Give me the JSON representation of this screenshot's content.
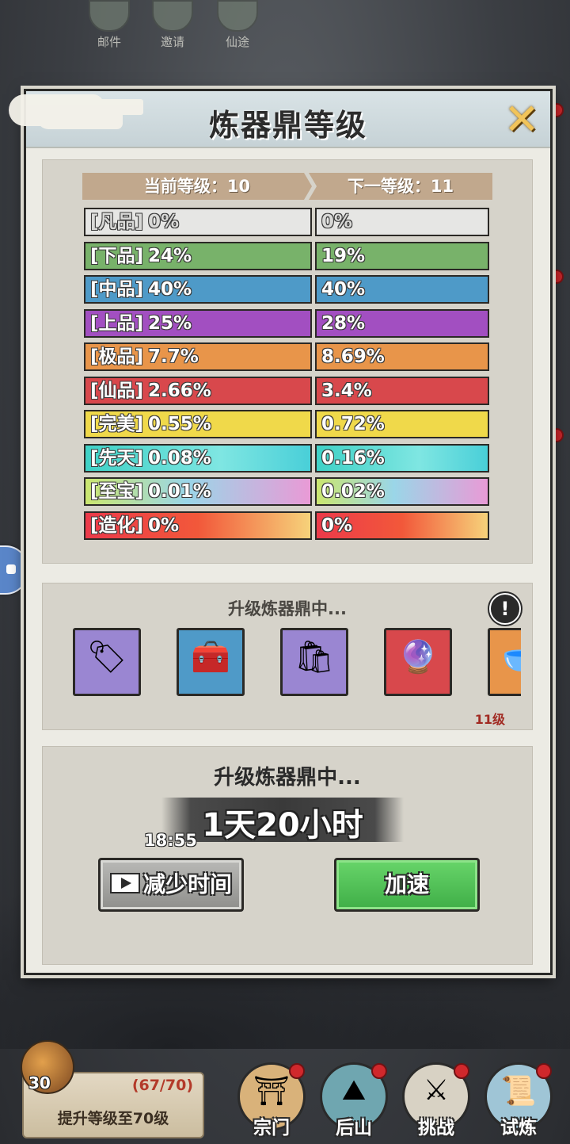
{
  "top_nav": [
    {
      "label": "邮件",
      "icon": "mail-icon"
    },
    {
      "label": "邀请",
      "icon": "invite-icon"
    },
    {
      "label": "仙途",
      "icon": "path-icon"
    }
  ],
  "dialog": {
    "title": "炼器鼎等级",
    "close_icon": "close-icon"
  },
  "levels": {
    "current": "当前等级：10",
    "next": "下一等级：11"
  },
  "rates": [
    {
      "grade": "[凡品]",
      "current": "0%",
      "next": "0%",
      "color": "#e6e6e4"
    },
    {
      "grade": "[下品]",
      "current": "24%",
      "next": "19%",
      "color": "#78b26a"
    },
    {
      "grade": "[中品]",
      "current": "40%",
      "next": "40%",
      "color": "#4e9ac8"
    },
    {
      "grade": "[上品]",
      "current": "25%",
      "next": "28%",
      "color": "#a24fc1"
    },
    {
      "grade": "[极品]",
      "current": "7.7%",
      "next": "8.69%",
      "color": "#e8954a"
    },
    {
      "grade": "[仙品]",
      "current": "2.66%",
      "next": "3.4%",
      "color": "#d8484c"
    },
    {
      "grade": "[完美]",
      "current": "0.55%",
      "next": "0.72%",
      "color": "#f0d94a"
    },
    {
      "grade": "[先天]",
      "current": "0.08%",
      "next": "0.16%",
      "color": "#4fd6d2"
    },
    {
      "grade": "[至宝]",
      "current": "0.01%",
      "next": "0.02%",
      "color": "#c88ad8"
    },
    {
      "grade": "[造化]",
      "current": "0%",
      "next": "0%",
      "color": "#ef5a3a"
    }
  ],
  "materials": {
    "title": "升级炼器鼎中...",
    "info_icon": "!",
    "items": [
      {
        "name": "gold-token-icon",
        "glyph": "🏷",
        "bg": "#9a86d2"
      },
      {
        "name": "blue-chest-icon",
        "glyph": "🧰",
        "bg": "#4f9ac8"
      },
      {
        "name": "flour-sack-icon",
        "glyph": "🛍",
        "bg": "#9a86d2"
      },
      {
        "name": "golden-orb-icon",
        "glyph": "🔮",
        "bg": "#d8484c"
      },
      {
        "name": "bowl-icon",
        "glyph": "🥣",
        "bg": "#e8954a"
      }
    ],
    "level_label": "11级"
  },
  "upgrade": {
    "title": "升级炼器鼎中...",
    "remaining": "1天20小时",
    "clock": "18:55",
    "reduce_label": "减少时间",
    "speedup_label": "加速"
  },
  "quest": {
    "chest_count": "30",
    "progress": "(67/70)",
    "text": "提升等级至70级"
  },
  "bottom_nav": [
    {
      "label": "宗门",
      "icon": "sect-gate-icon",
      "bg": "#d9b27a"
    },
    {
      "label": "后山",
      "icon": "mountain-icon",
      "bg": "#6fa6b0"
    },
    {
      "label": "挑战",
      "icon": "challenge-icon",
      "bg": "#d8d2c4"
    },
    {
      "label": "试炼",
      "icon": "trial-scroll-icon",
      "bg": "#9fc5d6"
    }
  ]
}
